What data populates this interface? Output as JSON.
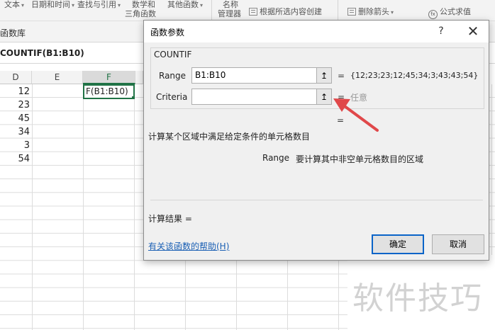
{
  "ribbon": {
    "items": {
      "text": "文本",
      "datetime": "日期和时间",
      "lookup": "查找与引用",
      "math_line1": "数学和",
      "math_line2": "三角函数",
      "other": "其他函数",
      "name_line1": "名称",
      "name_line2": "管理器",
      "create_from_selection": "根据所选内容创建",
      "remove_arrows": "删除箭头",
      "evaluate_formula": "公式求值"
    }
  },
  "group_label": "函数库",
  "formula_bar": {
    "text": "COUNTIF(B1:B10)"
  },
  "sheet": {
    "columns": [
      "D",
      "E",
      "F"
    ],
    "selected_column": "F",
    "d_values": [
      "12",
      "23",
      "45",
      "34",
      "3",
      "54"
    ],
    "active_cell_text": "F(B1:B10)"
  },
  "dialog": {
    "title": "函数参数",
    "help_glyph": "?",
    "close_glyph": "✕",
    "function_name": "COUNTIF",
    "args": [
      {
        "label": "Range",
        "value": "B1:B10",
        "result": "{12;23;23;12;45;34;3;43;43;54}"
      },
      {
        "label": "Criteria",
        "value": "",
        "result": "任意"
      }
    ],
    "equals": "=",
    "collapse_glyph": "↥",
    "description": "计算某个区域中满足给定条件的单元格数目",
    "arg_description_name": "Range",
    "arg_description_text": "要计算其中非空单元格数目的区域",
    "result_label": "计算结果 =",
    "help_link": "有关该函数的帮助(H)",
    "ok_label": "确定",
    "cancel_label": "取消"
  },
  "annotation": {
    "arrow_color": "#e0484a"
  },
  "watermark": "软件技巧"
}
